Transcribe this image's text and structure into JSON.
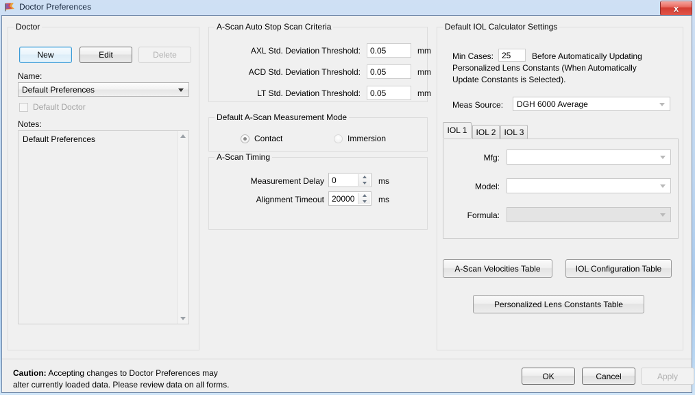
{
  "window": {
    "title": "Doctor Preferences",
    "icon": "flag-icon",
    "close_label": "x"
  },
  "doctor": {
    "legend": "Doctor",
    "buttons": {
      "new": "New",
      "edit": "Edit",
      "delete": "Delete"
    },
    "name_label": "Name:",
    "name_value": "Default Preferences",
    "default_doctor_label": "Default Doctor",
    "notes_label": "Notes:",
    "notes_value": "Default Preferences"
  },
  "auto_stop": {
    "legend": "A-Scan Auto Stop Scan Criteria",
    "rows": [
      {
        "label": "AXL Std. Deviation Threshold:",
        "value": "0.05",
        "unit": "mm"
      },
      {
        "label": "ACD Std. Deviation Threshold:",
        "value": "0.05",
        "unit": "mm"
      },
      {
        "label": "LT Std. Deviation Threshold:",
        "value": "0.05",
        "unit": "mm"
      }
    ]
  },
  "measurement_mode": {
    "legend": "Default A-Scan Measurement Mode",
    "contact": "Contact",
    "immersion": "Immersion",
    "selected": "Contact"
  },
  "timing": {
    "legend": "A-Scan Timing",
    "delay_label": "Measurement Delay",
    "delay_value": "0",
    "delay_unit": "ms",
    "timeout_label": "Alignment Timeout",
    "timeout_value": "20000",
    "timeout_unit": "ms"
  },
  "iol": {
    "legend": "Default IOL Calculator Settings",
    "min_cases_label": "Min Cases:",
    "min_cases_value": "25",
    "desc_line1": "Before Automatically Updating",
    "desc_line2": "Personalized Lens Constants (When Automatically",
    "desc_line3": "Update Constants is Selected).",
    "meas_source_label": "Meas Source:",
    "meas_source_value": "DGH 6000 Average",
    "tabs": [
      {
        "label": "IOL 1",
        "active": true
      },
      {
        "label": "IOL 2",
        "active": false
      },
      {
        "label": "IOL 3",
        "active": false
      }
    ],
    "fields": {
      "mfg_label": "Mfg:",
      "mfg_value": "",
      "model_label": "Model:",
      "model_value": "",
      "formula_label": "Formula:",
      "formula_value": ""
    },
    "buttons": {
      "velocities": "A-Scan Velocities Table",
      "configuration": "IOL Configuration Table",
      "personalized": "Personalized Lens Constants Table"
    }
  },
  "footer": {
    "caution_bold": "Caution:",
    "caution_line1": " Accepting changes to Doctor Preferences may",
    "caution_line2": "alter currently loaded data. Please review data on all forms.",
    "ok": "OK",
    "cancel": "Cancel",
    "apply": "Apply"
  },
  "colors": {
    "titlebar_blue": "#a8c9ec",
    "close_red": "#d33c31",
    "focus_blue": "#3c9bd6",
    "client_bg": "#f0f0f0"
  }
}
